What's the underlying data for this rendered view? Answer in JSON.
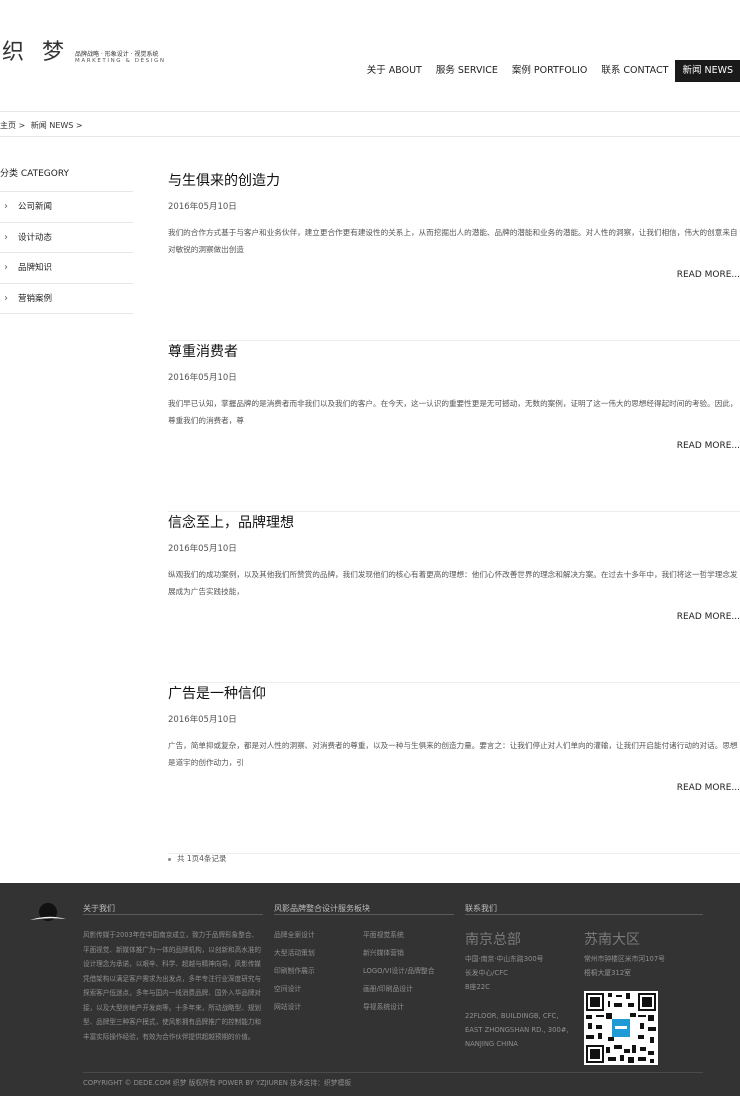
{
  "header": {
    "logo_mark": "织梦",
    "logo_tagline": "品牌战略 · 形象设计 · 视觉系统",
    "logo_subline": "MARKETING & DESIGN",
    "nav": [
      {
        "label": "关于 ABOUT",
        "active": false
      },
      {
        "label": "服务 SERVICE",
        "active": false
      },
      {
        "label": "案例 PORTFOLIO",
        "active": false
      },
      {
        "label": "联系 CONTACT",
        "active": false
      },
      {
        "label": "新闻 NEWS",
        "active": true
      }
    ]
  },
  "breadcrumb": [
    "主页 >",
    "新闻 NEWS >"
  ],
  "sidebar": {
    "title": "分类 CATEGORY",
    "items": [
      "公司新闻",
      "设计动态",
      "品牌知识",
      "营销案例"
    ]
  },
  "articles": [
    {
      "title": "与生俱来的创造力",
      "date": "2016年05月10日",
      "body": "我们的合作方式基于与客户和业务伙伴，建立更合作更有建设性的关系上，从而挖掘出人的潜能、品牌的潜能和业务的潜能。对人性的洞察，让我们相信，伟大的创意来自对敏锐的洞察做出创造",
      "more": "READ MORE..."
    },
    {
      "title": "尊重消费者",
      "date": "2016年05月10日",
      "body": "我们早已认知，掌握品牌的是消费者而非我们以及我们的客户。在今天，这一认识的重要性更是无可撼动，无数的案例，证明了这一伟大的思想经得起时间的考验。因此，尊重我们的消费者，尊",
      "more": "READ MORE..."
    },
    {
      "title": "信念至上，品牌理想",
      "date": "2016年05月10日",
      "body": "纵观我们的成功案例，以及其他我们所赞赏的品牌，我们发现他们的核心有着更高的理想：他们心怀改善世界的理念和解决方案。在过去十多年中，我们将这一哲学理念发展成为广告实践技能，",
      "more": "READ MORE..."
    },
    {
      "title": "广告是一种信仰",
      "date": "2016年05月10日",
      "body": "广告，简单抑或复杂，都是对人性的洞察、对消费者的尊重，以及一种与生俱来的创造力量。要言之：让我们停止对人们单向的灌输，让我们开启能付诸行动的对话。思想是道宇的创作动力，引",
      "more": "READ MORE..."
    }
  ],
  "pagination": "共 1页4条记录",
  "footer": {
    "about_title": "关于我们",
    "about_text": "风影传媒于2003年在中国南京成立，致力于品牌形象整合、平面视觉、新媒体推广为一体的品牌机构，以创新和高水准的设计理念为承诺，以艰辛、科学、超越与精神向导，风影传媒凭借架构以满足客户需求为出发点，多年专注行业深度研究与探索客户低迷点，多年与国内一线消费品牌、国外入华品牌对接，以及大型房地产开发商等。十多年来，所动战略型、规划型、品牌型三种客户模式，使风影拥有品牌推广的控制能力和丰富实际操作经验，有效为合作伙伴提供超越预期的价值。",
    "services_title": "风影品牌整合设计服务板块",
    "services": [
      "品牌全案设计",
      "平面视觉系统",
      "大型活动策划",
      "新兴媒体营销",
      "印刷制作展示",
      "LOGO/VI设计/品牌整合",
      "空间设计",
      "画册/印刷品设计",
      "网站设计",
      "导视系统设计"
    ],
    "contact_title": "联系我们",
    "nanjing_city": "南京总部",
    "nanjing_addr": [
      "中国·南京·中山东路300号",
      "长发中心/CFC",
      "B座22C"
    ],
    "nanjing_addr_en": [
      "22FLOOR, BUILDINGB, CFC,",
      "EAST ZHONGSHAN RD., 300#,",
      "NANJING CHINA"
    ],
    "sunan_city": "苏南大区",
    "sunan_addr": [
      "常州市钟楼区米市河107号",
      "梧桐大厦312室"
    ],
    "copyright": "COPYRIGHT © DEDE.COM 织梦 版权所有 POWER BY YZJIUREN 技术支持：织梦模板"
  }
}
